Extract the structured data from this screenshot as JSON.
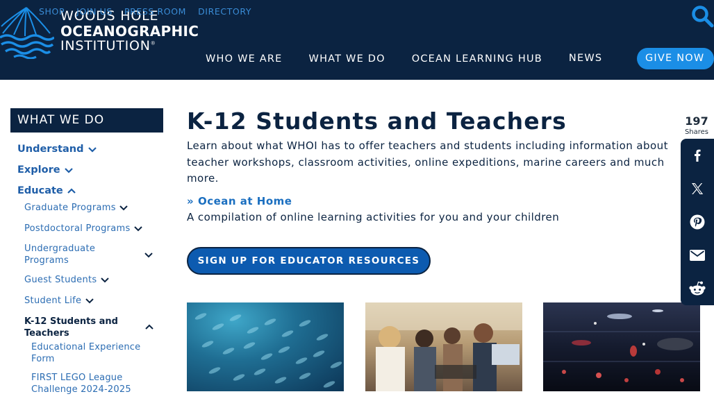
{
  "header": {
    "util_nav": [
      "SHOP",
      "JOIN US",
      "PRESS ROOM",
      "DIRECTORY"
    ],
    "logo": {
      "line1": "WOODS HOLE",
      "line2": "OCEANOGRAPHIC",
      "line3": "INSTITUTION",
      "registered": "®"
    },
    "main_nav": [
      "WHO WE ARE",
      "WHAT WE DO",
      "OCEAN LEARNING HUB",
      "NEWS"
    ],
    "give_label": "GIVE NOW",
    "search_icon": "search-icon"
  },
  "sidebar": {
    "heading": "WHAT WE DO",
    "top_items": [
      "Understand",
      "Explore",
      "Educate"
    ],
    "educate_children": [
      "Graduate Programs",
      "Postdoctoral Programs",
      "Undergraduate Programs",
      "Guest Students",
      "Student Life"
    ],
    "active_item": "K-12 Students and Teachers",
    "active_children": [
      "Educational Experience Form",
      "FIRST LEGO League Challenge 2024-2025"
    ]
  },
  "main": {
    "title": "K-12 Students and Teachers",
    "intro": "Learn about what WHOI has to offer teachers and students including information about teacher workshops, classroom activities, online expeditions, marine careers and much more.",
    "link_label": "Ocean at Home",
    "link_description": "A compilation of online learning activities for you and your children",
    "cta_label": "SIGN UP FOR EDUCATOR RESOURCES"
  },
  "share": {
    "count": "197",
    "label": "Shares",
    "buttons": [
      "facebook-icon",
      "x-twitter-icon",
      "pinterest-icon",
      "email-icon",
      "reddit-icon"
    ]
  },
  "colors": {
    "navy": "#0b2341",
    "link_blue": "#1b6fc0",
    "give_blue": "#1b8ee6",
    "cta_blue": "#0d5bb0",
    "util_blue": "#3a8cd6"
  }
}
